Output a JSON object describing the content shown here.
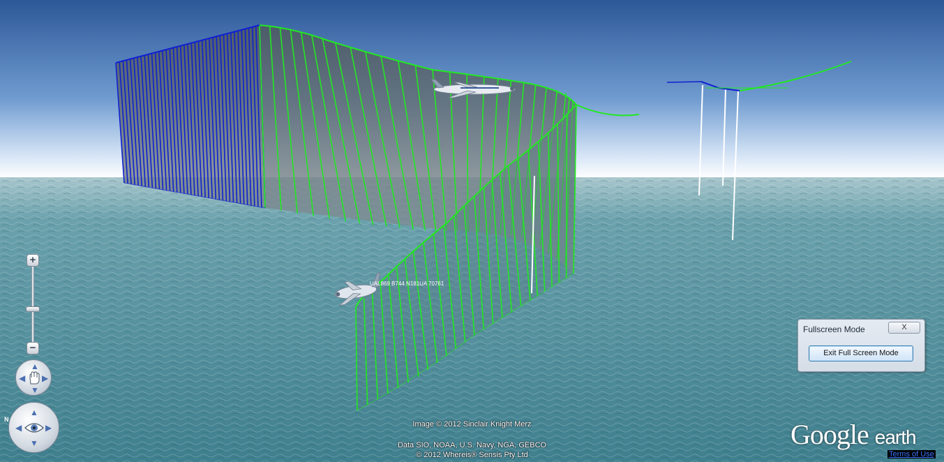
{
  "app": {
    "name": "Google earth"
  },
  "scene": {
    "aircraft": [
      {
        "kind": "airplane",
        "label": ""
      },
      {
        "kind": "airplane",
        "label": "UAL869 B744 N181UA 70761"
      }
    ],
    "colors": {
      "sky_top": "#2d5898",
      "sky_horizon": "#ffffff",
      "ocean": "#4a8a98",
      "track_blue": "#1020d0",
      "track_green": "#22e822",
      "curtain_fill": "#5a6870",
      "extrude_white": "#ffffff"
    }
  },
  "navigation": {
    "zoom_in_label": "+",
    "zoom_out_label": "−",
    "zoom_level_fraction": 0.55,
    "north_label": "N",
    "look_icon": "hand-icon",
    "move_icon": "eye-icon"
  },
  "fullscreen_dialog": {
    "title": "Fullscreen Mode",
    "close_label": "X",
    "exit_button_label": "Exit Full Screen Mode"
  },
  "credits": {
    "image": "Image © 2012 Sinclair Knight Merz",
    "data_line1": "Data SIO, NOAA, U.S. Navy, NGA, GEBCO",
    "data_line2": "© 2012 Whereis® Sensis Pty Ltd"
  },
  "logo": {
    "word1": "Google",
    "word2": "earth"
  },
  "terms_link": "Terms of Use"
}
